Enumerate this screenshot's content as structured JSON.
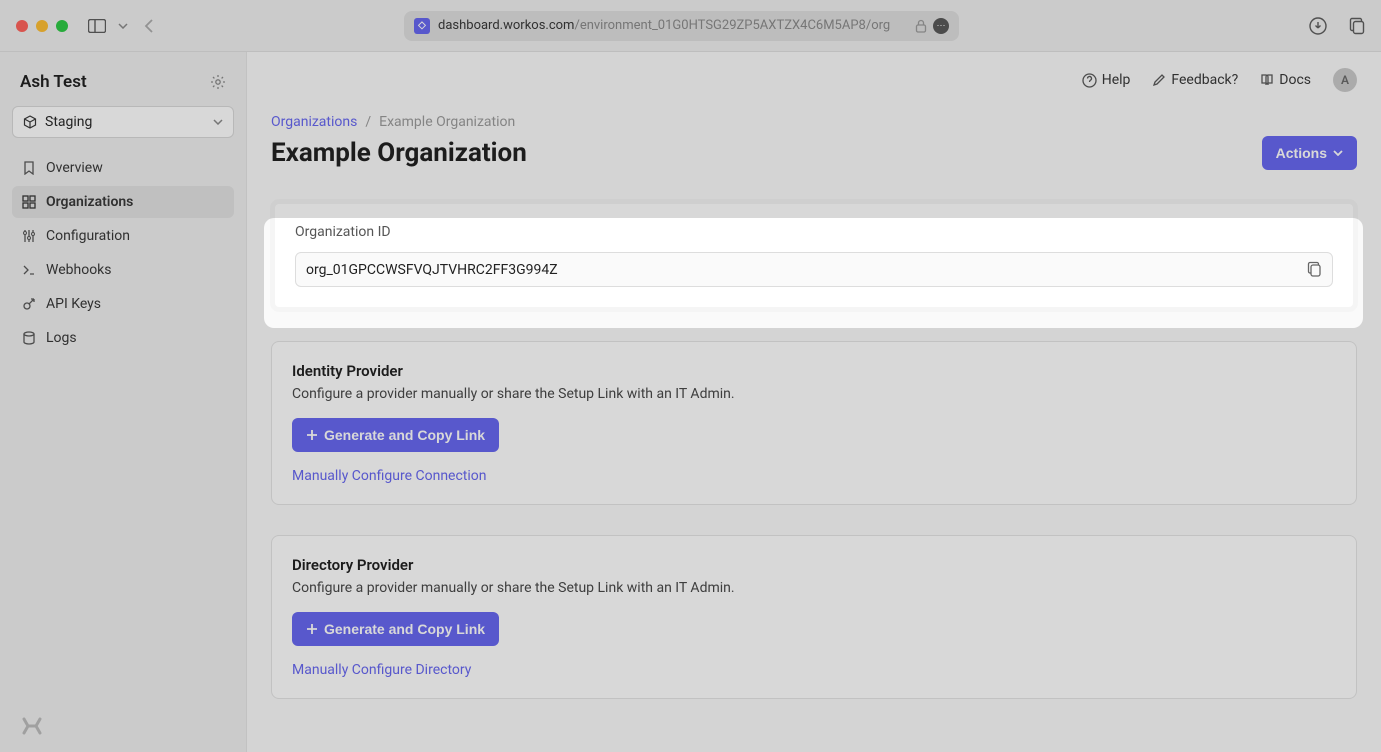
{
  "browser": {
    "url_host": "dashboard.workos.com",
    "url_path": "/environment_01G0HTSG29ZP5AXTZX4C6M5AP8/org"
  },
  "sidebar": {
    "workspace": "Ash Test",
    "environment": "Staging",
    "items": [
      {
        "label": "Overview"
      },
      {
        "label": "Organizations"
      },
      {
        "label": "Configuration"
      },
      {
        "label": "Webhooks"
      },
      {
        "label": "API Keys"
      },
      {
        "label": "Logs"
      }
    ]
  },
  "topbar": {
    "help": "Help",
    "feedback": "Feedback?",
    "docs": "Docs",
    "avatar_initial": "A"
  },
  "breadcrumb": {
    "root": "Organizations",
    "current": "Example Organization"
  },
  "page": {
    "title": "Example Organization",
    "actions_label": "Actions"
  },
  "org_id": {
    "label": "Organization ID",
    "value": "org_01GPCCWSFVQJTVHRC2FF3G994Z"
  },
  "identity": {
    "title": "Identity Provider",
    "desc": "Configure a provider manually or share the Setup Link with an IT Admin.",
    "button": "Generate and Copy Link",
    "link": "Manually Configure Connection"
  },
  "directory": {
    "title": "Directory Provider",
    "desc": "Configure a provider manually or share the Setup Link with an IT Admin.",
    "button": "Generate and Copy Link",
    "link": "Manually Configure Directory"
  }
}
